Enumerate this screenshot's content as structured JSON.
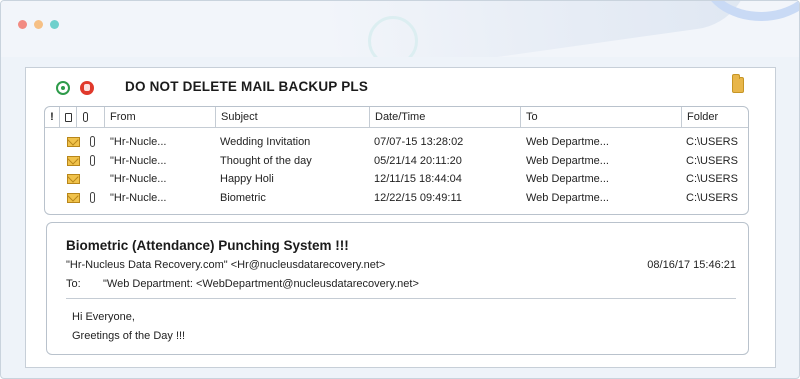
{
  "window": {
    "mail_title": "DO NOT DELETE MAIL BACKUP PLS"
  },
  "icons": {
    "toolbar_left": "chrome-icon",
    "toolbar_right": "hand-stop-icon",
    "folder": "folder-icon",
    "row_mail": "envelope-icon",
    "row_attachment": "paperclip-icon"
  },
  "colors": {
    "envelope": "#f0c24b",
    "chrome_green": "#2e9b4a",
    "stop_red": "#e0392b",
    "folder_yellow": "#e8b64a"
  },
  "list": {
    "columns": {
      "importance": "!",
      "from": "From",
      "subject": "Subject",
      "datetime": "Date/Time",
      "to": "To",
      "folder": "Folder"
    },
    "rows": [
      {
        "from": "\"Hr-Nucle...",
        "subject": "Wedding Invitation",
        "datetime": "07/07-15 13:28:02",
        "to": "Web Departme...",
        "folder": "C:\\USERS",
        "attachment": true
      },
      {
        "from": "\"Hr-Nucle...",
        "subject": "Thought of the day",
        "datetime": "05/21/14 20:11:20",
        "to": "Web Departme...",
        "folder": "C:\\USERS",
        "attachment": true
      },
      {
        "from": "\"Hr-Nucle...",
        "subject": "Happy Holi",
        "datetime": "12/11/15 18:44:04",
        "to": "Web Departme...",
        "folder": "C:\\USERS",
        "attachment": false
      },
      {
        "from": "\"Hr-Nucle...",
        "subject": "Biometric",
        "datetime": "12/22/15 09:49:11",
        "to": "Web Departme...",
        "folder": "C:\\USERS",
        "attachment": true
      }
    ]
  },
  "preview": {
    "subject": "Biometric (Attendance) Punching System !!!",
    "from": "\"Hr-Nucleus Data Recovery.com\" <Hr@nucleusdatarecovery.net>",
    "date": "08/16/17 15:46:21",
    "to_label": "To:",
    "to": "\"Web Department: <WebDepartment@nucleusdatarecovery.net>",
    "body_line1": "Hi Everyone,",
    "body_line2": "Greetings of the Day !!!"
  }
}
